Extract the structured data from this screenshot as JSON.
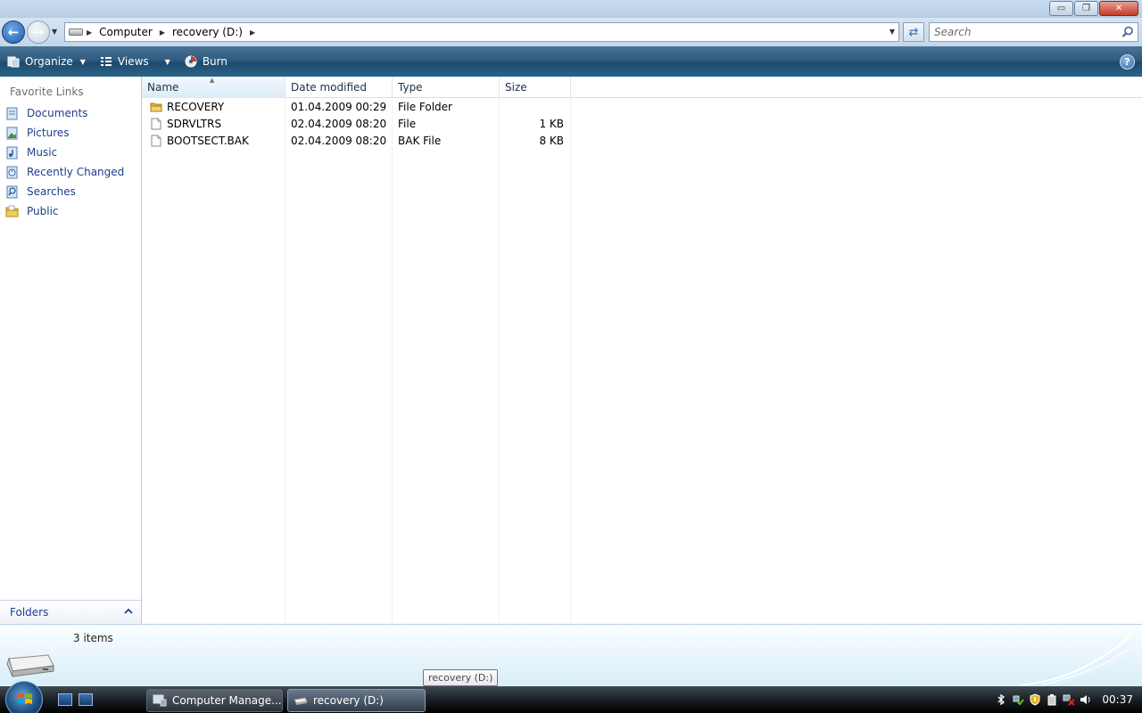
{
  "window": {
    "buttons": {
      "minimize": "▭",
      "maximize": "❐",
      "close": "✕"
    }
  },
  "address": {
    "crumbs": [
      "Computer",
      "recovery (D:)"
    ],
    "search_placeholder": "Search"
  },
  "toolbar": {
    "organize": "Organize",
    "views": "Views",
    "burn": "Burn",
    "help": "?"
  },
  "sidebar": {
    "title": "Favorite Links",
    "items": [
      {
        "label": "Documents",
        "icon": "documents-icon"
      },
      {
        "label": "Pictures",
        "icon": "pictures-icon"
      },
      {
        "label": "Music",
        "icon": "music-icon"
      },
      {
        "label": "Recently Changed",
        "icon": "recently-changed-icon"
      },
      {
        "label": "Searches",
        "icon": "searches-icon"
      },
      {
        "label": "Public",
        "icon": "public-folder-icon"
      }
    ],
    "folders_label": "Folders"
  },
  "filelist": {
    "columns": [
      "Name",
      "Date modified",
      "Type",
      "Size"
    ],
    "rows": [
      {
        "name": "RECOVERY",
        "date": "01.04.2009 00:29",
        "type": "File Folder",
        "size": "",
        "icon": "folder-icon"
      },
      {
        "name": "SDRVLTRS",
        "date": "02.04.2009 08:20",
        "type": "File",
        "size": "1 KB",
        "icon": "file-icon"
      },
      {
        "name": "BOOTSECT.BAK",
        "date": "02.04.2009 08:20",
        "type": "BAK File",
        "size": "8 KB",
        "icon": "file-icon"
      }
    ]
  },
  "details": {
    "item_count": "3 items"
  },
  "tooltip": "recovery (D:)",
  "taskbar": {
    "tasks": [
      "Computer Manage...",
      "recovery (D:)"
    ],
    "clock": "00:37"
  },
  "colors": {
    "link": "#1e3f8c",
    "toolbar": "#2e5b80",
    "close_button": "#c43b26"
  }
}
